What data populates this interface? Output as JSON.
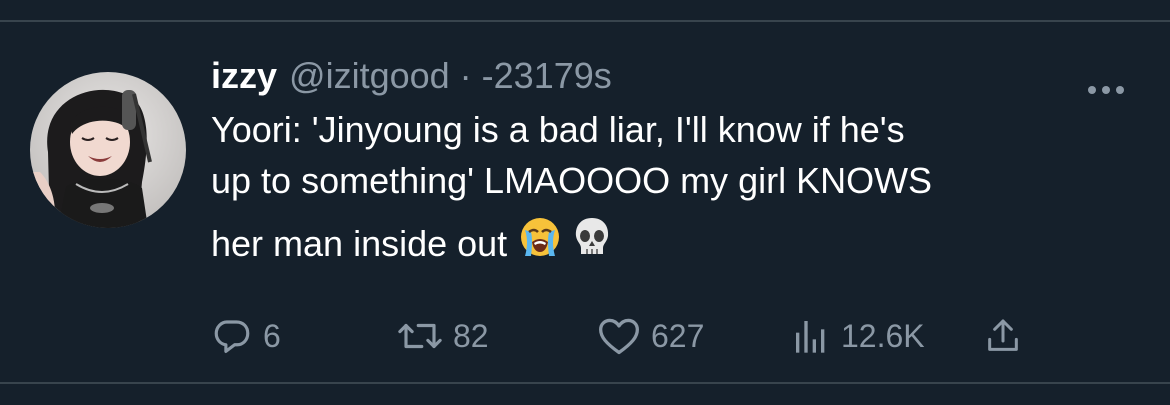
{
  "tweet": {
    "display_name": "izzy",
    "handle": "@izitgood",
    "separator": "·",
    "time": "-23179s",
    "text_lines": [
      "Yoori: 'Jinyoung is a bad liar, I'll know if he's",
      "up to something' LMAOOOO my girl KNOWS",
      "her man inside out"
    ],
    "emojis": [
      "loudly-crying-face",
      "skull"
    ]
  },
  "actions": {
    "replies": "6",
    "retweets": "82",
    "likes": "627",
    "views": "12.6K"
  },
  "colors": {
    "background": "#15202b",
    "text_primary": "#ffffff",
    "text_secondary": "#8b98a5",
    "divider": "#38444d"
  }
}
